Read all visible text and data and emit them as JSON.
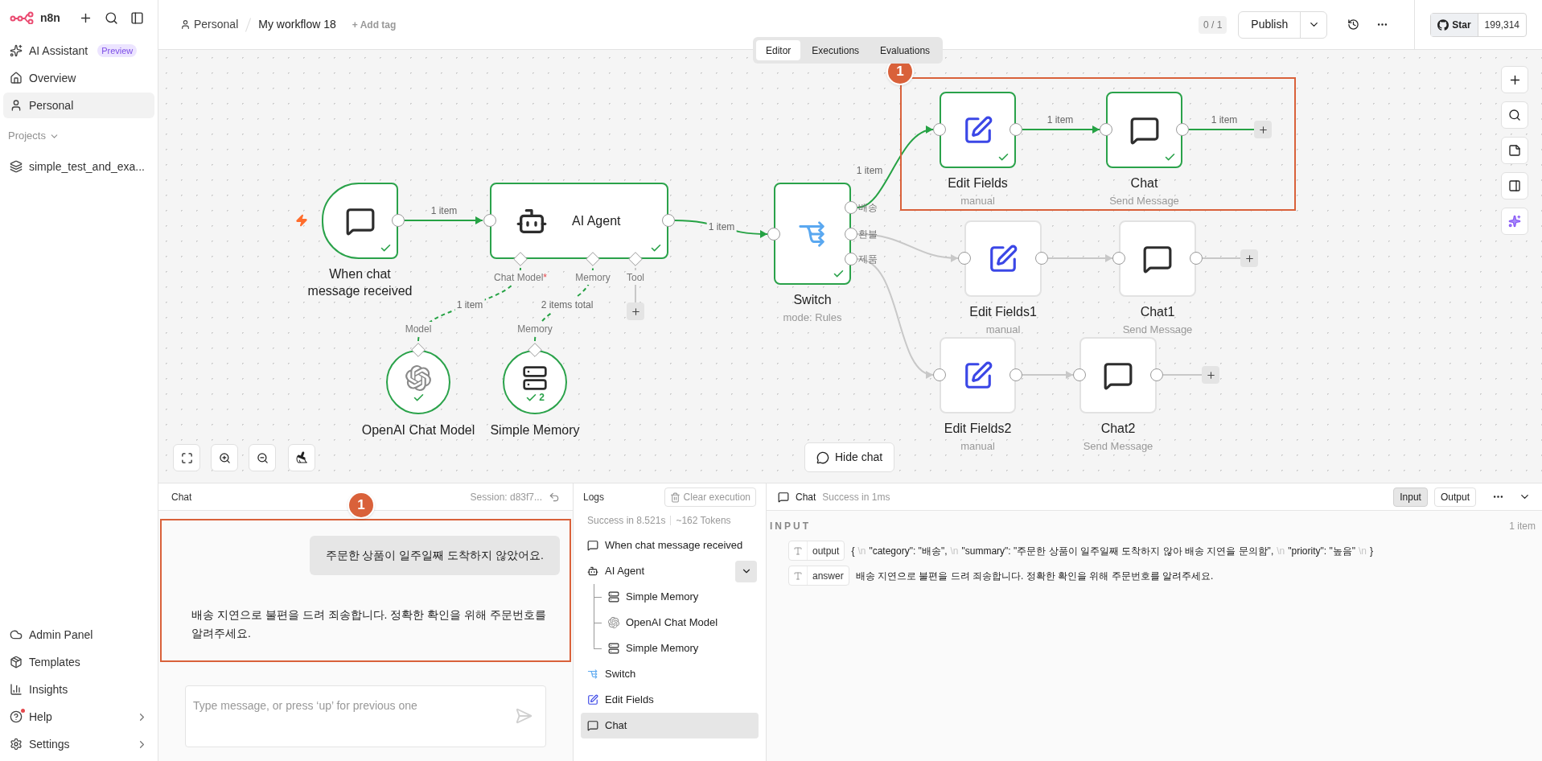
{
  "sidebar": {
    "brand": "n8n",
    "items": [
      {
        "label": "AI Assistant",
        "badge": "Preview",
        "kind": "sparkle",
        "selected": false
      },
      {
        "label": "Overview",
        "kind": "home",
        "selected": false
      },
      {
        "label": "Personal",
        "kind": "user",
        "selected": true
      }
    ],
    "projects_label": "Projects",
    "projects": [
      {
        "label": "simple_test_and_exa...",
        "kind": "layers"
      }
    ],
    "bottom_items": [
      {
        "label": "Admin Panel",
        "kind": "cloud",
        "has_submenu": false,
        "notification": false
      },
      {
        "label": "Templates",
        "kind": "package",
        "has_submenu": false,
        "notification": false
      },
      {
        "label": "Insights",
        "kind": "chart",
        "has_submenu": false,
        "notification": false
      },
      {
        "label": "Help",
        "kind": "help",
        "has_submenu": true,
        "notification": true
      },
      {
        "label": "Settings",
        "kind": "settings",
        "has_submenu": true,
        "notification": false
      }
    ]
  },
  "header": {
    "project": "Personal",
    "workflow": "My workflow 18",
    "add_tag": "+ Add tag",
    "counter": "0 / 1",
    "publish": "Publish",
    "github_label": "Star",
    "github_count": "199,314"
  },
  "view_tabs": [
    {
      "label": "Editor",
      "selected": true
    },
    {
      "label": "Executions",
      "selected": false
    },
    {
      "label": "Evaluations",
      "selected": false
    }
  ],
  "canvas": {
    "nodes": [
      {
        "name": "When chat message received",
        "kind": "chat_trigger",
        "success": true
      },
      {
        "name": "AI Agent",
        "kind": "agent",
        "success": true,
        "ports": [
          {
            "label": "Chat Model",
            "required_mark": "*"
          },
          {
            "label": "Memory"
          },
          {
            "label": "Tool"
          }
        ]
      },
      {
        "name": "Switch",
        "subtitle": "mode: Rules",
        "kind": "switch",
        "success": true,
        "ports": [
          {
            "label": "배송"
          },
          {
            "label": "환불"
          },
          {
            "label": "제품"
          }
        ]
      },
      {
        "name": "Edit Fields",
        "subtitle": "manual",
        "kind": "edit",
        "success": true
      },
      {
        "name": "Chat",
        "subtitle": "Send Message",
        "kind": "chat",
        "success": true
      },
      {
        "name": "Edit Fields1",
        "subtitle": "manual",
        "kind": "edit",
        "success": false
      },
      {
        "name": "Chat1",
        "subtitle": "Send Message",
        "kind": "chat",
        "success": false
      },
      {
        "name": "OpenAI Chat Model",
        "kind": "model",
        "success": true,
        "ports": [
          {
            "label": "Model"
          }
        ]
      },
      {
        "name": "Simple Memory",
        "kind": "memory",
        "success": true,
        "run_count": "2",
        "ports": [
          {
            "label": "Memory"
          }
        ]
      },
      {
        "name": "Edit Fields2",
        "subtitle": "manual",
        "kind": "edit",
        "success": false
      },
      {
        "name": "Chat2",
        "subtitle": "Send Message",
        "kind": "chat",
        "success": false
      }
    ],
    "edges": [
      {
        "label": "1 item",
        "active": true
      },
      {
        "label": "1 item",
        "active": true
      },
      {
        "label": "1 item",
        "active": true
      },
      {
        "label": "1 item",
        "active": true
      },
      {
        "label": "1 item",
        "active": true
      },
      {
        "active": false
      },
      {
        "active": false
      },
      {
        "active": false
      },
      {
        "active": false
      },
      {
        "active": false
      },
      {
        "active": false
      },
      {
        "label": "1 item",
        "active": true
      },
      {
        "label": "2 items total",
        "active": true
      },
      {
        "active": false
      }
    ],
    "highlight_badge": "1",
    "hide_chat": "Hide chat"
  },
  "chat": {
    "title": "Chat",
    "session": "Session: d83f7...",
    "highlight_badge": "1",
    "messages": [
      {
        "kind": "user",
        "text": "주문한 상품이 일주일째 도착하지 않았어요."
      },
      {
        "kind": "bot",
        "text": "배송 지연으로 불편을 드려 죄송합니다. 정확한 확인을 위해 주문번호를 알려주세요."
      }
    ],
    "input": {
      "placeholder": "Type message, or press ‘up’ for previous one"
    }
  },
  "logs": {
    "title": "Logs",
    "clear": "Clear execution",
    "summary": "Success in 8.521s",
    "tokens": "~162 Tokens",
    "items": [
      {
        "label": "When chat message received",
        "kind": "chat",
        "selected": false
      },
      {
        "label": "AI Agent",
        "kind": "agent",
        "selected": false,
        "expanded": true,
        "children": [
          {
            "label": "Simple Memory",
            "kind": "memory",
            "selected": false
          },
          {
            "label": "OpenAI Chat Model",
            "kind": "model",
            "selected": false
          },
          {
            "label": "Simple Memory",
            "kind": "memory",
            "selected": false
          }
        ]
      },
      {
        "label": "Switch",
        "kind": "switch",
        "selected": false
      },
      {
        "label": "Edit Fields",
        "kind": "edit",
        "selected": false
      },
      {
        "label": "Chat",
        "kind": "chat",
        "selected": true
      }
    ]
  },
  "details": {
    "node": "Chat",
    "status": "Success in 1ms",
    "tabs": [
      {
        "label": "Input",
        "selected": true
      },
      {
        "label": "Output",
        "selected": false
      }
    ],
    "section": "INPUT",
    "count": "1 item",
    "fields": [
      {
        "name": "output",
        "parts": [
          {
            "text": "{",
            "kind": "text"
          },
          {
            "text": "\\n",
            "kind": "escape"
          },
          {
            "text": "\"category\": \"배송\",",
            "kind": "text"
          },
          {
            "text": "\\n",
            "kind": "escape"
          },
          {
            "text": "\"summary\": \"주문한 상품이 일주일째 도착하지 않아 배송 지연을 문의함\",",
            "kind": "text"
          },
          {
            "text": "\\n",
            "kind": "escape"
          },
          {
            "text": "\"priority\": \"높음\"",
            "kind": "text"
          },
          {
            "text": "\\n",
            "kind": "escape"
          },
          {
            "text": "}",
            "kind": "text"
          }
        ]
      },
      {
        "name": "answer",
        "parts": [
          {
            "text": "배송 지연으로 불편을 드려 죄송합니다. 정확한 확인을 위해 주문번호를 알려주세요.",
            "kind": "text"
          }
        ]
      }
    ]
  }
}
